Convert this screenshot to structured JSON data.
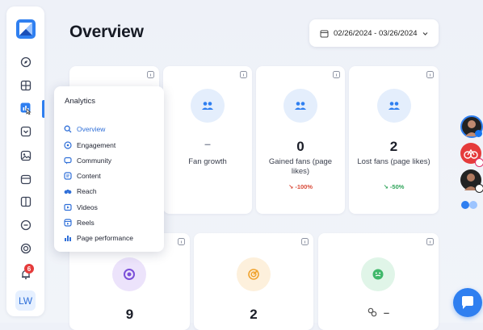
{
  "sidebar": {
    "bell_badge": "6",
    "avatar_initials": "LW"
  },
  "header": {
    "title": "Overview",
    "date_range": "02/26/2024 - 03/26/2024"
  },
  "flyout": {
    "title": "Analytics",
    "items": [
      {
        "label": "Overview",
        "icon": "search-icon",
        "active": true
      },
      {
        "label": "Engagement",
        "icon": "engagement-icon"
      },
      {
        "label": "Community",
        "icon": "community-icon"
      },
      {
        "label": "Content",
        "icon": "content-icon"
      },
      {
        "label": "Reach",
        "icon": "binoculars-icon"
      },
      {
        "label": "Videos",
        "icon": "video-icon"
      },
      {
        "label": "Reels",
        "icon": "reels-icon"
      },
      {
        "label": "Page performance",
        "icon": "chart-icon"
      }
    ]
  },
  "cards_top": [
    {
      "value": "",
      "label": ""
    },
    {
      "value": "–",
      "label": "Fan growth",
      "change": ""
    },
    {
      "value": "0",
      "label": "Gained fans (page likes)",
      "change": "↘ -100%",
      "trend": "down"
    },
    {
      "value": "2",
      "label": "Lost fans (page likes)",
      "change": "↘ -50%",
      "trend": "up"
    }
  ],
  "cards_bottom": [
    {
      "value": "9",
      "color": "#7b4fd9"
    },
    {
      "value": "2",
      "color": "#f0a431"
    },
    {
      "value": "–",
      "color": "#3fb86a"
    }
  ],
  "colors": {
    "accent": "#2f7ff0",
    "badge": "#e53b3b",
    "down": "#d94a38",
    "up": "#2fa45a"
  }
}
